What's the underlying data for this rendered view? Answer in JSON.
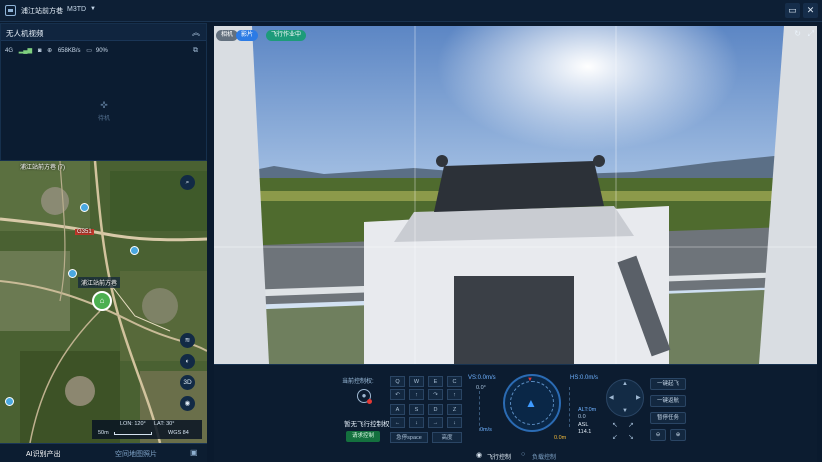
{
  "app": {
    "title": "浦江站前方巷",
    "device": "M3TD",
    "dropdown_icon": "caret-down-icon"
  },
  "topbar": {
    "message_icon": "message-icon",
    "close_label": "✕"
  },
  "drone_panel": {
    "title": "无人机视频",
    "status": {
      "network": "4G",
      "signal": "▮▮▮",
      "speed": "658KB/s",
      "battery": "90%"
    },
    "offline_label": "待机"
  },
  "map": {
    "top_label": "浦江站前方巷 (7)",
    "road_label": "G351",
    "station_label": "浦江站前方巷",
    "buttons": [
      "⌕",
      "≋",
      "◐",
      "3D",
      "◉"
    ],
    "scale": {
      "distance": "50m",
      "lon": "LON: 120°",
      "lat": "LAT: 30°",
      "datum": "WGS 84"
    }
  },
  "bottom_tabs": {
    "ai": "AI识别产出",
    "space": "空间地图照片"
  },
  "video": {
    "chips": {
      "mode": "相机",
      "source": "影片",
      "status": "飞行作业中"
    }
  },
  "control": {
    "authority_label": "当前控制权:",
    "no_control": "暂无飞行控制权",
    "request_btn": "请求控制",
    "keys": [
      "Q",
      "W",
      "E",
      "C",
      "A",
      "S",
      "D",
      "Z"
    ],
    "space_label": "急停space",
    "height_label": "高度",
    "vs": "VS:0.0m/s",
    "hs": "HS:0.0m/s",
    "pitch": "0.0°",
    "speed_bottom": "0m/s",
    "alt_label": "ALT:0m",
    "alt_value": "0.0",
    "asl_label": "ASL",
    "asl_value": "114.1",
    "ground_value": "0.0m",
    "right_btns": [
      "一键起飞",
      "一键返航",
      "暂停任务"
    ],
    "flight_ctrl": "飞行控制",
    "payload_ctrl": "负载控制"
  }
}
